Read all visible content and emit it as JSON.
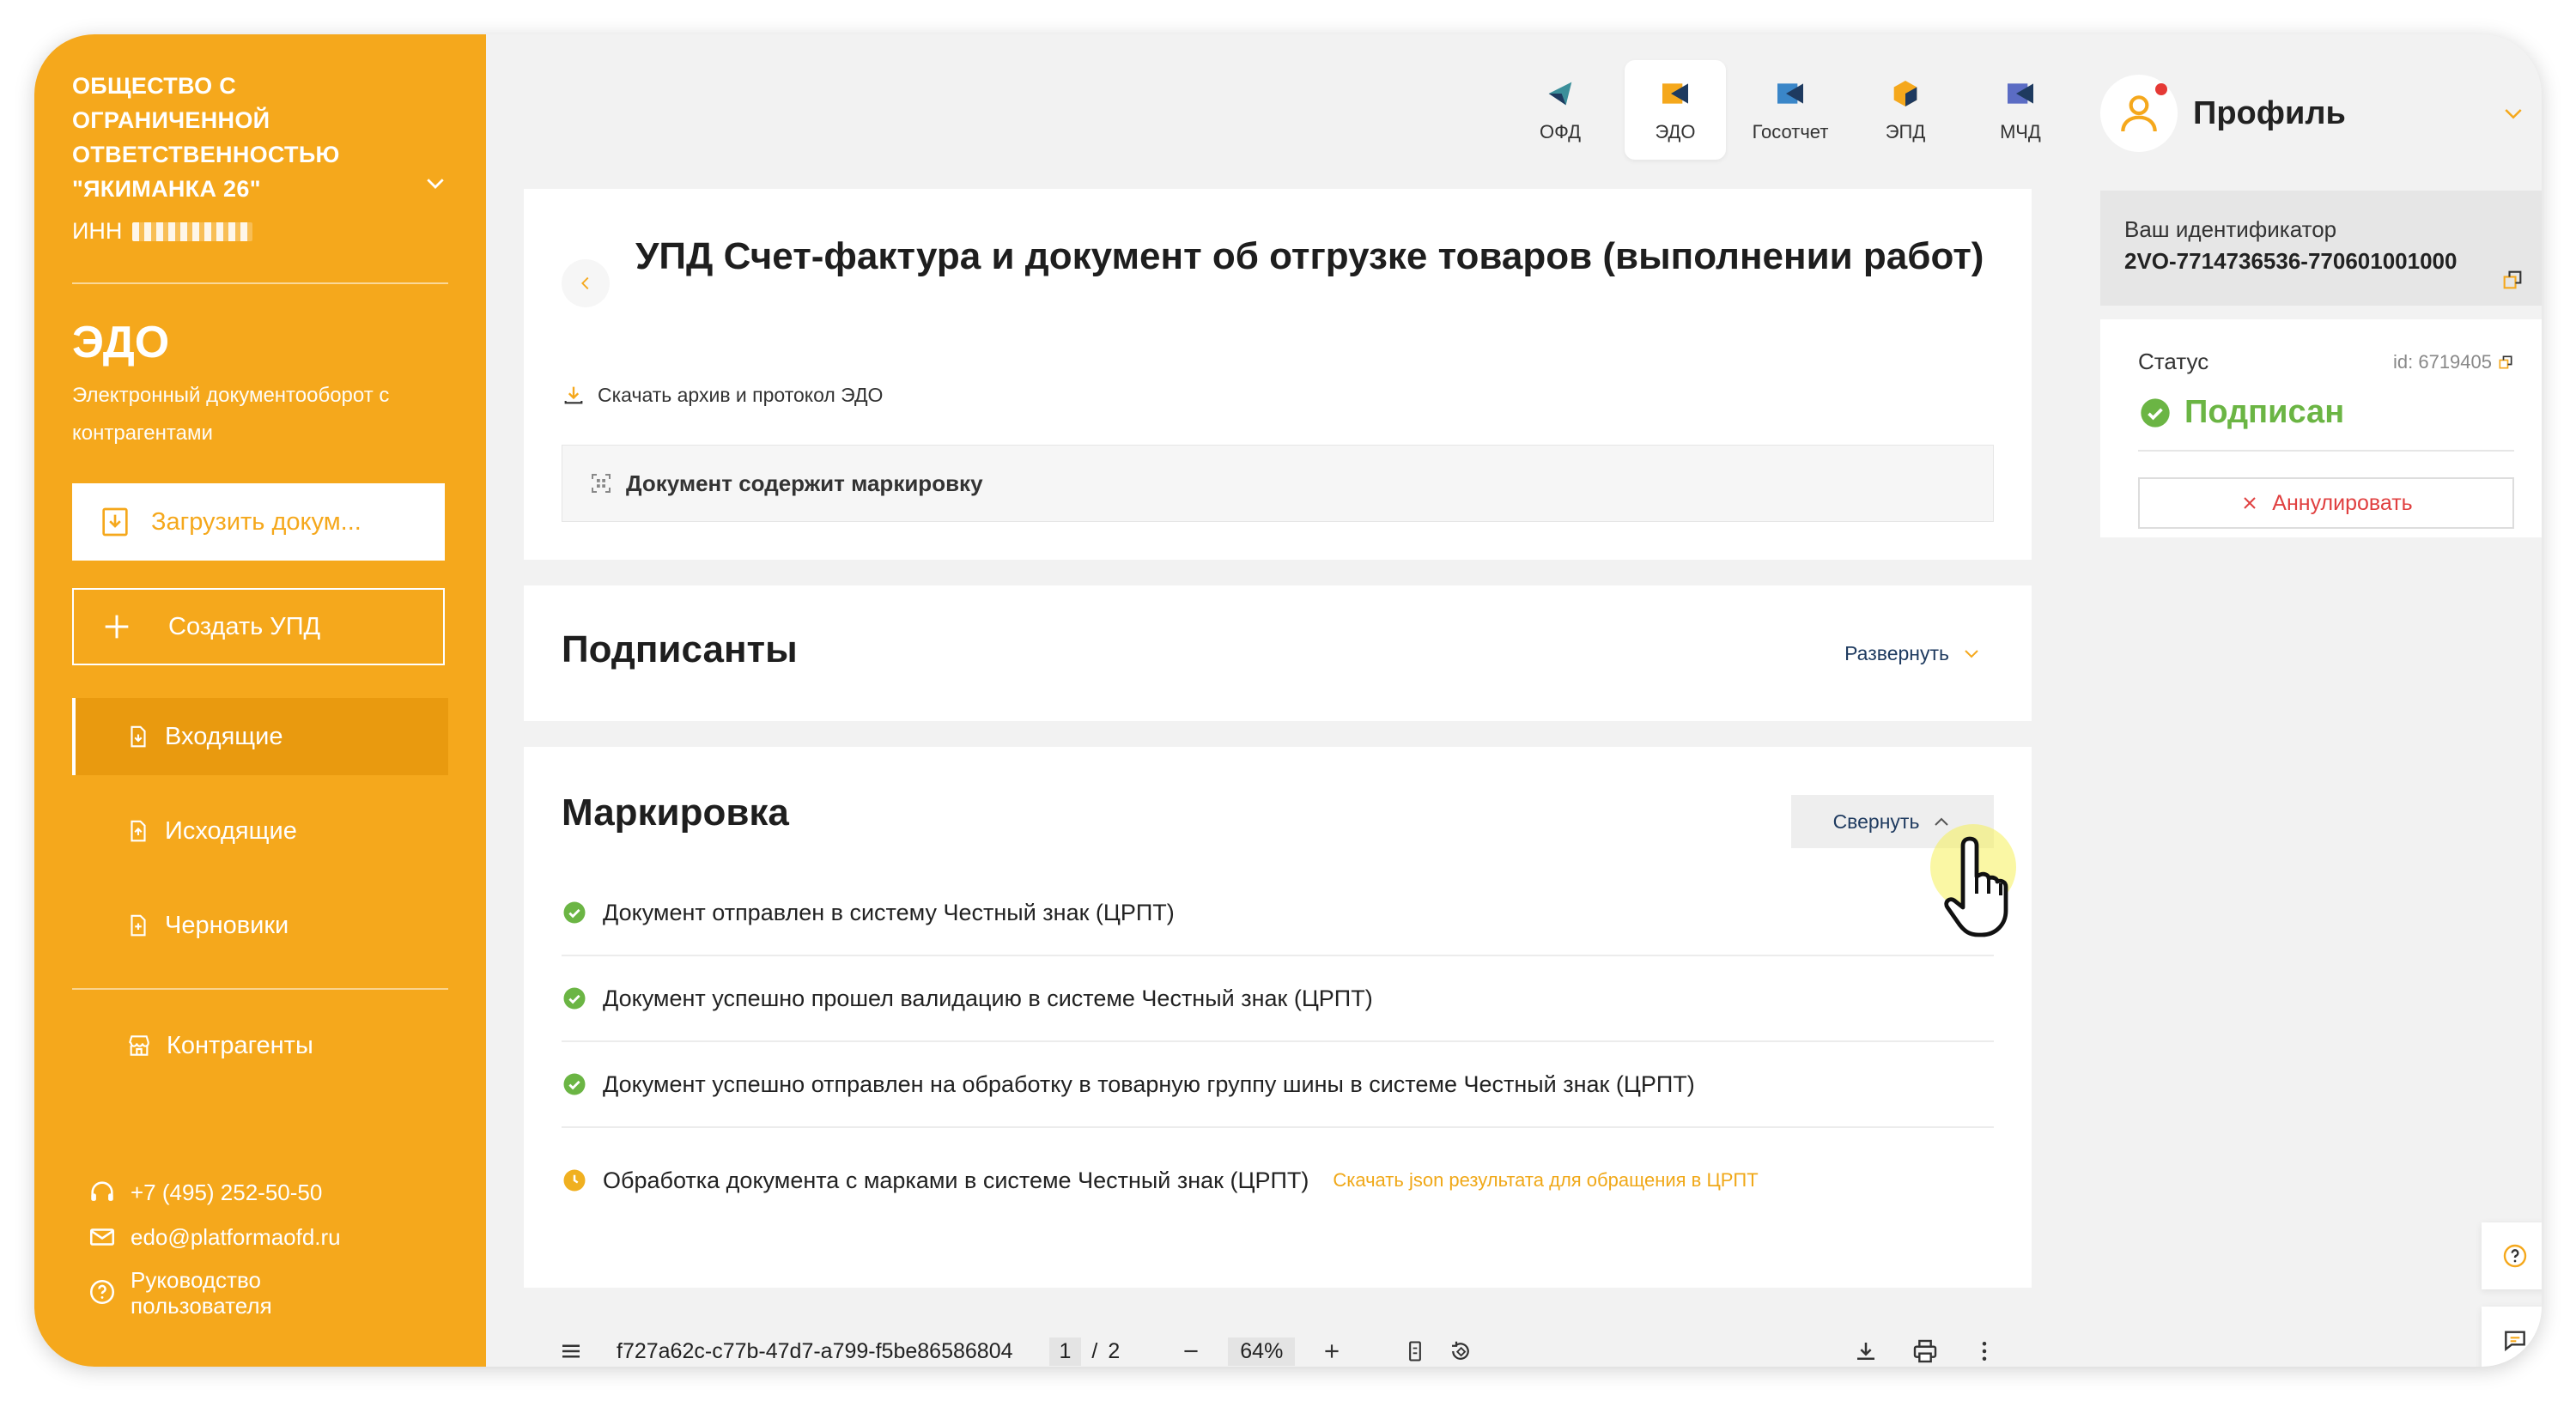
{
  "sidebar": {
    "org_name": "Общество с ограниченной ответственностью \"Якиманка 26\"",
    "inn_label": "ИНН",
    "module_title": "ЭДО",
    "module_desc": "Электронный документооборот с контрагентами",
    "upload_label": "Загрузить докум...",
    "create_label": "Создать УПД",
    "nav": [
      {
        "label": "Входящие"
      },
      {
        "label": "Исходящие"
      },
      {
        "label": "Черновики"
      },
      {
        "label": "Контрагенты"
      }
    ],
    "phone": "+7 (495) 252-50-50",
    "email": "edo@platformaofd.ru",
    "guide": "Руководство пользователя",
    "accent_color": "#f5a81c"
  },
  "tabs": [
    {
      "label": "ОФД",
      "icon": "ofd-icon"
    },
    {
      "label": "ЭДО",
      "icon": "edo-icon",
      "active": true
    },
    {
      "label": "Госотчет",
      "icon": "gosotchet-icon"
    },
    {
      "label": "ЭПД",
      "icon": "epd-icon"
    },
    {
      "label": "МЧД",
      "icon": "mchd-icon"
    }
  ],
  "document": {
    "title": "УПД Счет-фактура и документ об отгрузке товаров (выполнении работ)",
    "download_link": "Скачать архив и протокол ЭДО",
    "marking_banner": "Документ содержит маркировку"
  },
  "signers": {
    "title": "Подписанты",
    "expand_label": "Развернуть"
  },
  "marking": {
    "title": "Маркировка",
    "collapse_label": "Свернуть",
    "statuses": [
      {
        "text": "Документ отправлен в систему Честный знак (ЦРПТ)",
        "state": "done"
      },
      {
        "text": "Документ успешно прошел валидацию в системе Честный знак (ЦРПТ)",
        "state": "done"
      },
      {
        "text": "Документ успешно отправлен на обработку в товарную группу шины в системе Честный знак (ЦРПТ)",
        "state": "done"
      },
      {
        "text": "Обработка документа с марками в системе Честный знак (ЦРПТ)",
        "state": "pending",
        "link": "Скачать json результата для обращения в ЦРПТ"
      }
    ]
  },
  "pdf": {
    "filename": "f727a62c-c77b-47d7-a799-f5be86586804",
    "page": "1",
    "separator": "/",
    "total_pages": "2",
    "zoom": "64%"
  },
  "profile": {
    "name": "Профиль",
    "id_label": "Ваш идентификатор",
    "id_value": "2VO-7714736536-770601001000"
  },
  "status": {
    "label": "Статус",
    "id": "id: 6719405",
    "value": "Подписан",
    "annul_label": "Аннулировать",
    "success_color": "#6bb544",
    "danger_color": "#e04040"
  }
}
